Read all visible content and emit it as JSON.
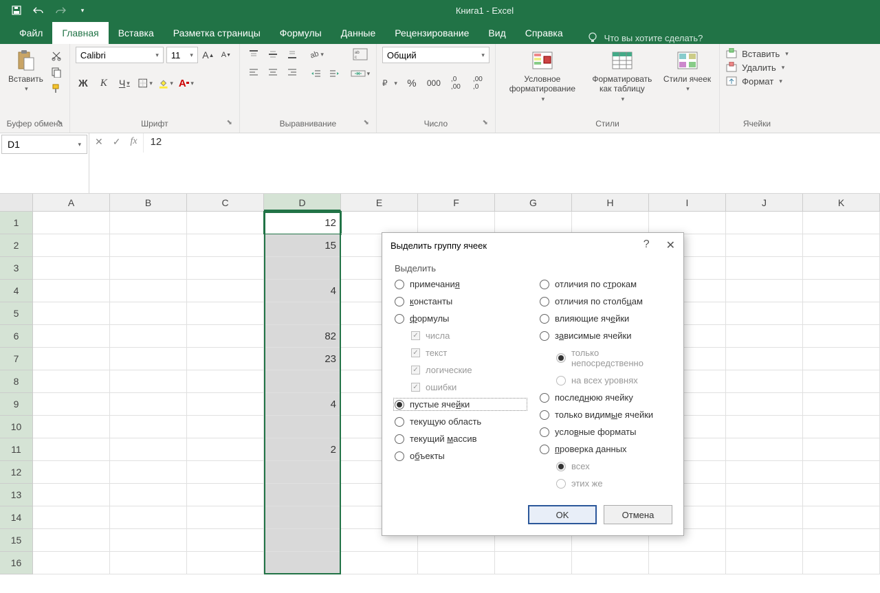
{
  "app": {
    "title": "Книга1  -  Excel"
  },
  "tabs": {
    "file": "Файл",
    "home": "Главная",
    "insert": "Вставка",
    "layout": "Разметка страницы",
    "formulas": "Формулы",
    "data": "Данные",
    "review": "Рецензирование",
    "view": "Вид",
    "help": "Справка",
    "tellme": "Что вы хотите сделать?"
  },
  "ribbon": {
    "clipboard": {
      "paste": "Вставить",
      "label": "Буфер обмена"
    },
    "font": {
      "name": "Calibri",
      "size": "11",
      "label": "Шрифт"
    },
    "align": {
      "label": "Выравнивание"
    },
    "number": {
      "format": "Общий",
      "label": "Число"
    },
    "styles": {
      "cond": "Условное форматирование",
      "table": "Форматировать как таблицу",
      "cell": "Стили ячеек",
      "label": "Стили"
    },
    "cells": {
      "insert": "Вставить",
      "delete": "Удалить",
      "format": "Формат",
      "label": "Ячейки"
    }
  },
  "namebox": "D1",
  "formula": "12",
  "columns": [
    "A",
    "B",
    "C",
    "D",
    "E",
    "F",
    "G",
    "H",
    "I",
    "J",
    "K"
  ],
  "rows": [
    "1",
    "2",
    "3",
    "4",
    "5",
    "6",
    "7",
    "8",
    "9",
    "10",
    "11",
    "12",
    "13",
    "14",
    "15",
    "16"
  ],
  "cellData": {
    "D1": "12",
    "D2": "15",
    "D4": "4",
    "D6": "82",
    "D7": "23",
    "D9": "4",
    "D11": "2"
  },
  "dialog": {
    "title": "Выделить группу ячеек",
    "section": "Выделить",
    "left": {
      "notes": "примечания",
      "constants": "константы",
      "formulas": "формулы",
      "numbers": "числа",
      "text": "текст",
      "logical": "логические",
      "errors": "ошибки",
      "blanks": "пустые ячейки",
      "region": "текущую область",
      "array": "текущий массив",
      "objects": "объекты"
    },
    "right": {
      "rowdiff": "отличия по строкам",
      "coldiff": "отличия по столбцам",
      "precedents": "влияющие ячейки",
      "dependents": "зависимые ячейки",
      "direct": "только непосредственно",
      "all_levels": "на всех уровнях",
      "last": "последнюю ячейку",
      "visible": "только видимые ячейки",
      "cond": "условные форматы",
      "valid": "проверка данных",
      "all": "всех",
      "same": "этих же"
    },
    "ok": "OK",
    "cancel": "Отмена"
  }
}
